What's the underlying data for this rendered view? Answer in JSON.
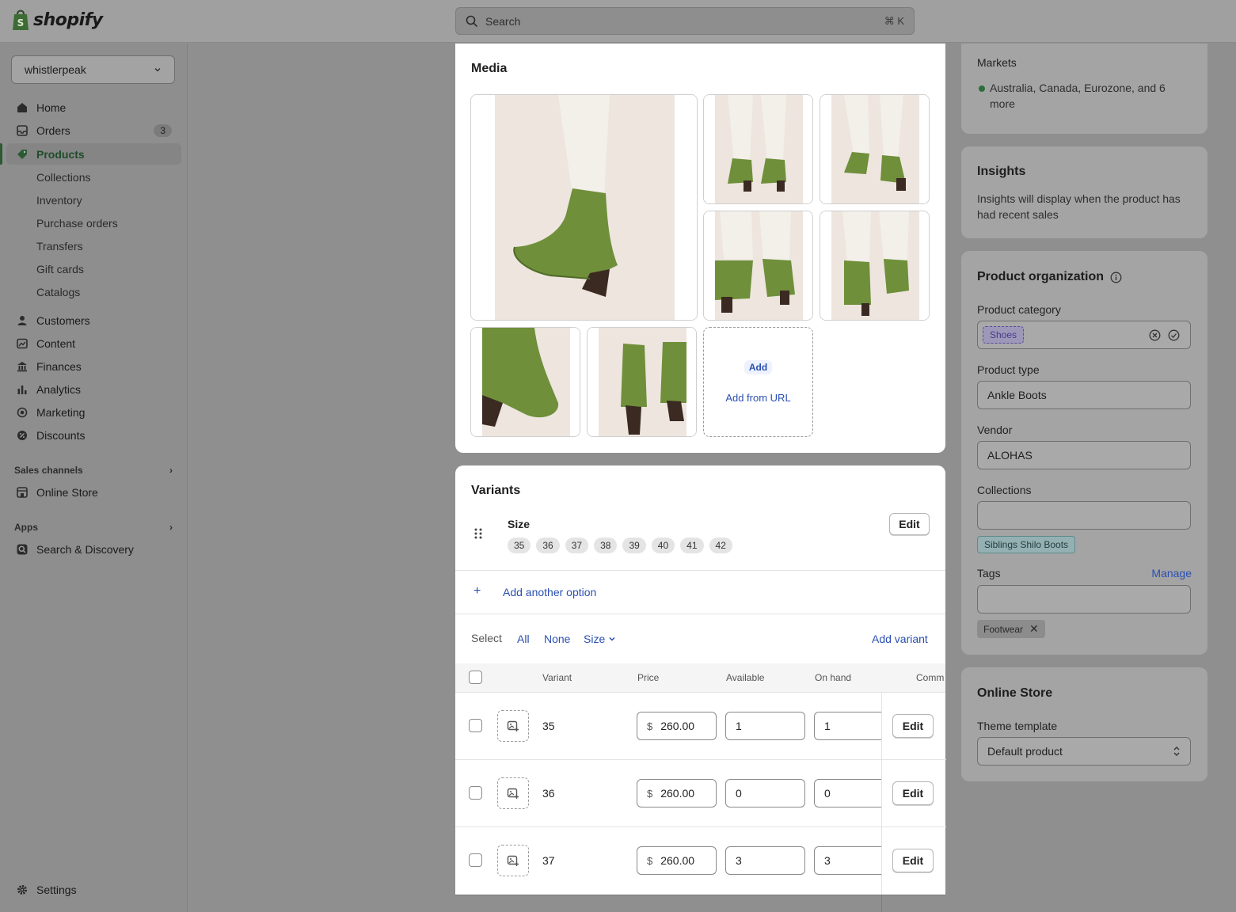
{
  "brand": {
    "name": "shopify"
  },
  "search": {
    "placeholder": "Search",
    "shortcut": "⌘ K"
  },
  "store": {
    "name": "whistlerpeak"
  },
  "nav": {
    "home": "Home",
    "orders": "Orders",
    "orders_count": "3",
    "products": "Products",
    "collections": "Collections",
    "inventory": "Inventory",
    "purchase_orders": "Purchase orders",
    "transfers": "Transfers",
    "gift_cards": "Gift cards",
    "catalogs": "Catalogs",
    "customers": "Customers",
    "content": "Content",
    "finances": "Finances",
    "analytics": "Analytics",
    "marketing": "Marketing",
    "discounts": "Discounts",
    "sales_channels": "Sales channels",
    "online_store": "Online Store",
    "apps": "Apps",
    "search_discovery": "Search & Discovery",
    "settings": "Settings"
  },
  "media": {
    "title": "Media",
    "add_label": "Add",
    "add_url_label": "Add from URL"
  },
  "variants": {
    "title": "Variants",
    "option_name": "Size",
    "option_values": [
      "35",
      "36",
      "37",
      "38",
      "39",
      "40",
      "41",
      "42"
    ],
    "edit_label": "Edit",
    "add_option_label": "Add another option",
    "select_label": "Select",
    "select_all": "All",
    "select_none": "None",
    "select_size": "Size",
    "add_variant_label": "Add variant",
    "columns": {
      "variant": "Variant",
      "price": "Price",
      "available": "Available",
      "on_hand": "On hand",
      "committed": "Comm"
    },
    "currency": "$",
    "rows": [
      {
        "variant": "35",
        "price": "260.00",
        "available": "1",
        "on_hand": "1",
        "action": "Edit"
      },
      {
        "variant": "36",
        "price": "260.00",
        "available": "0",
        "on_hand": "0",
        "action": "Edit"
      },
      {
        "variant": "37",
        "price": "260.00",
        "available": "3",
        "on_hand": "3",
        "action": "Edit"
      }
    ]
  },
  "markets": {
    "title": "Markets",
    "text": "Australia, Canada, Eurozone, and 6 more",
    "status_color": "#2b6e3c"
  },
  "insights": {
    "title": "Insights",
    "text": "Insights will display when the product has had recent sales"
  },
  "organization": {
    "title": "Product organization",
    "category_label": "Product category",
    "category_value": "Shoes",
    "type_label": "Product type",
    "type_value": "Ankle Boots",
    "vendor_label": "Vendor",
    "vendor_value": "ALOHAS",
    "collections_label": "Collections",
    "collection_chip": "Siblings Shilo Boots",
    "tags_label": "Tags",
    "tags_manage": "Manage",
    "tag_chip": "Footwear"
  },
  "online_store_card": {
    "title": "Online Store",
    "template_label": "Theme template",
    "template_value": "Default product"
  },
  "colors": {
    "accent_link": "#2a4fb1",
    "active_nav": "#1f4d2a",
    "boot_green": "#6f8f3a"
  }
}
